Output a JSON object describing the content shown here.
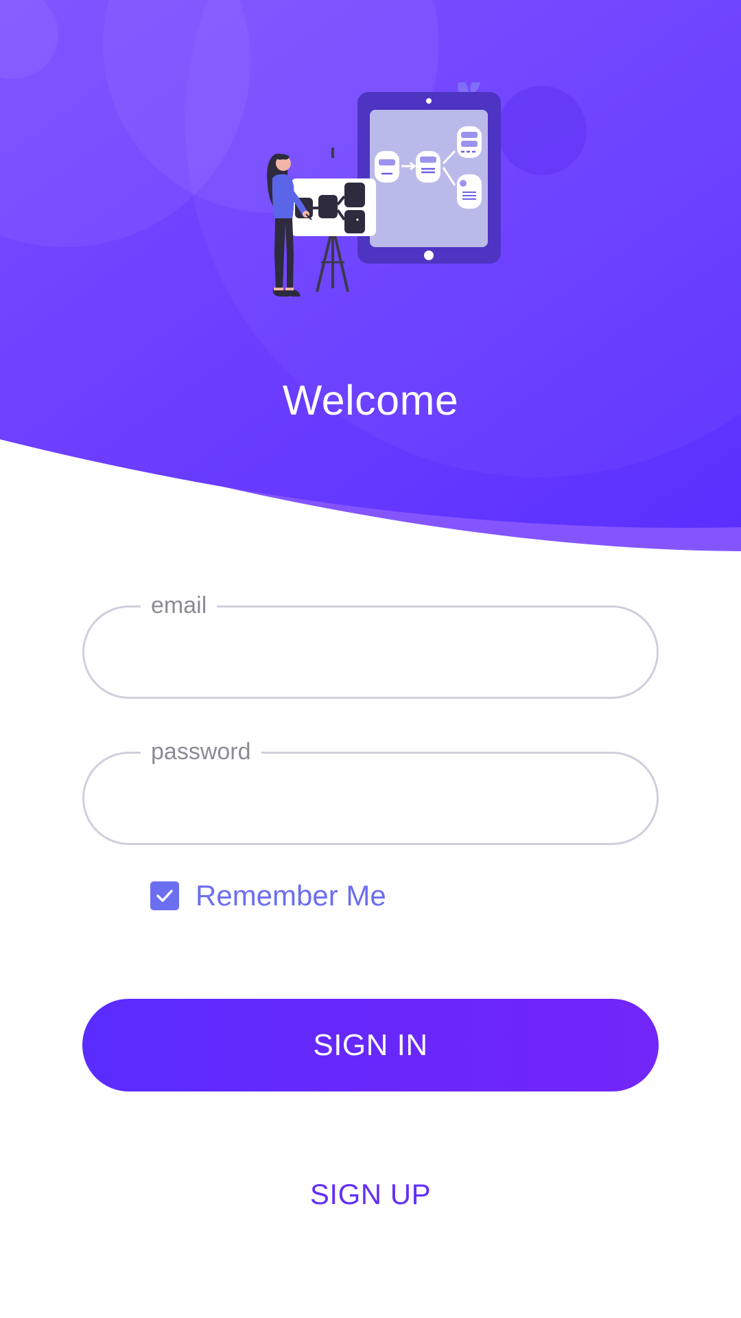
{
  "header": {
    "title": "Welcome",
    "illustration": "woman-presenting-flowchart-illustration"
  },
  "form": {
    "email": {
      "label": "email",
      "value": ""
    },
    "password": {
      "label": "password",
      "value": ""
    },
    "remember_me": {
      "label": "Remember Me",
      "checked": true
    }
  },
  "actions": {
    "sign_in_label": "SIGN IN",
    "sign_up_label": "SIGN UP"
  },
  "colors": {
    "header_gradient_start": "#7a48ff",
    "header_gradient_end": "#5b30ff",
    "accent": "#6c6ef0",
    "button_gradient_start": "#5a2cff",
    "button_gradient_end": "#7226fa",
    "field_border": "#cfcfdc",
    "label_gray": "#8b8b96"
  },
  "icons": {
    "checkbox": "check-icon"
  }
}
